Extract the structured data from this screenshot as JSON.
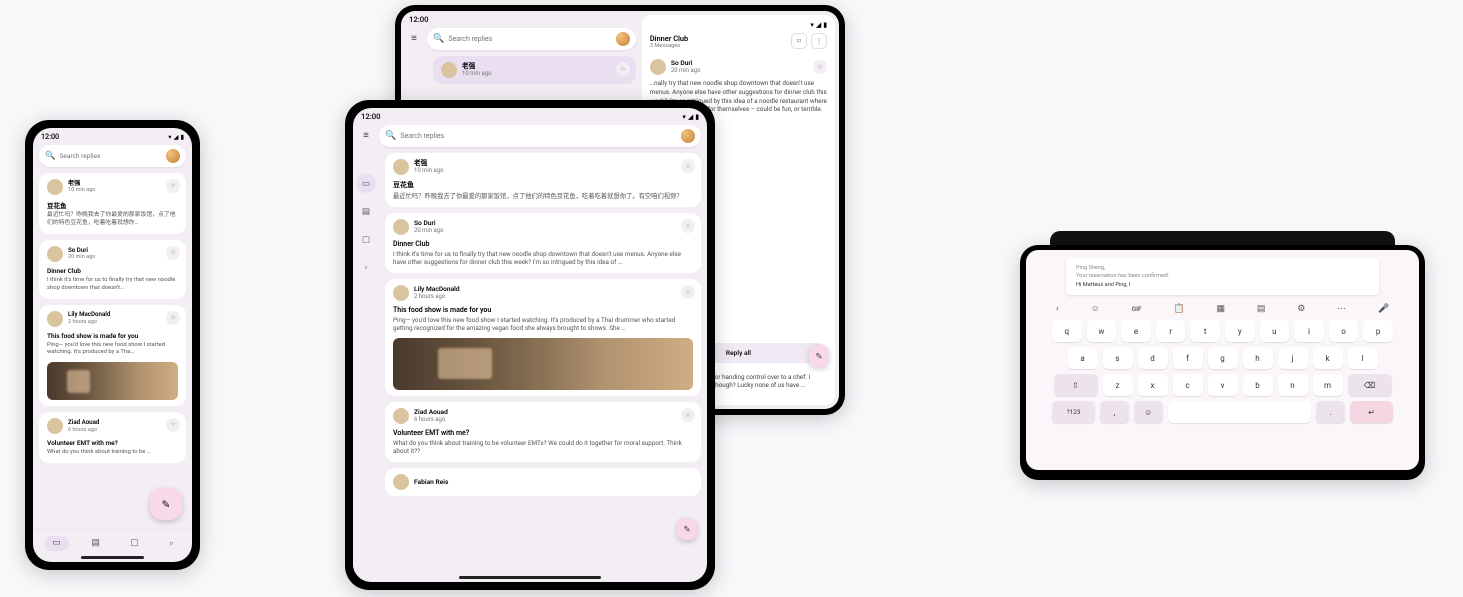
{
  "status": {
    "time": "12:00"
  },
  "search": {
    "placeholder": "Search replies"
  },
  "threads": [
    {
      "name": "老强",
      "time": "10 min ago",
      "title": "豆花鱼",
      "body_short": "最近忙吗？昨晚我去了你最爱的那家饭馆，点了他们的特色豆花鱼，吃着吃着就想你…",
      "body_med": "最近忙吗？昨晚我去了你最爱的那家饭馆，点了他们的特色豆花鱼，吃着吃着就想你了。有空咱们视频？"
    },
    {
      "name": "So Duri",
      "time": "20 min ago",
      "title": "Dinner Club",
      "body_short": "I think it's time for us to finally try that new noodle shop downtown that doesn't…",
      "body_med": "I think it's time for us to finally try that new noodle shop downtown that doesn't use menus. Anyone else have other suggestions for dinner club this week? I'm so intrigued by this idea of …"
    },
    {
      "name": "Lily MacDonald",
      "time": "2 hours ago",
      "title": "This food show is made for you",
      "body_short": "Ping— you'd love this new food show I started watching. It's produced by a Tha…",
      "body_med": "Ping— you'd love this new food show I started watching. It's produced by a Thai drummer who started getting recognized for the amazing vegan food she always brought to shows. She …"
    },
    {
      "name": "Ziad Aouad",
      "time": "6 hours ago",
      "title": "Volunteer EMT with me?",
      "body_short": "What do you think about training to be …",
      "body_med": "What do you think about training to be volunteer EMTs? We could do it together for moral support. Think about it??"
    },
    {
      "name": "Fabian Reis",
      "time": "",
      "title": "",
      "body_short": "",
      "body_med": ""
    }
  ],
  "detail": {
    "title": "Dinner Club",
    "subtitle": "3 Messages",
    "sender": "So Duri",
    "sender_time": "20 min ago",
    "body1": "…nally try that new noodle shop downtown that doesn't use menus. Anyone else have other suggestions for dinner club this week? I'm so intrigued by this idea of a noodle restaurant where no one gets to order for themselves – could be fun, or terrible.",
    "reply_label": "Reply all",
    "body2": "…ace! I'm definitely up for handing control over to a chef. I wonder what happens though? Lucky none of us have …concerned"
  },
  "tabletop": {
    "doc_line1": "Ping Sheng,",
    "doc_line2": "Your reservation has been confirmed!",
    "doc_line3": "Hi Matteus and Ping, I",
    "gif": "GIF",
    "sym": "?123"
  },
  "keyboard": {
    "r1": [
      "q",
      "w",
      "e",
      "r",
      "t",
      "y",
      "u",
      "i",
      "o",
      "p"
    ],
    "r2": [
      "a",
      "s",
      "d",
      "f",
      "g",
      "h",
      "j",
      "k",
      "l"
    ],
    "r3": [
      "z",
      "x",
      "c",
      "v",
      "b",
      "n",
      "m"
    ]
  }
}
